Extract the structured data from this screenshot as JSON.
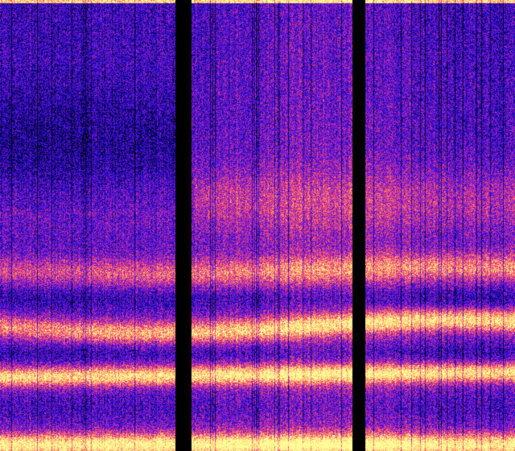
{
  "colormap": {
    "name": "magma-like",
    "stops": [
      "#000000",
      "#0c0470",
      "#2a10d8",
      "#7a18d8",
      "#d8308f",
      "#ff6a5a",
      "#ffd080",
      "#ffff9a"
    ]
  },
  "panels": 3,
  "gap_color": "#000000"
}
